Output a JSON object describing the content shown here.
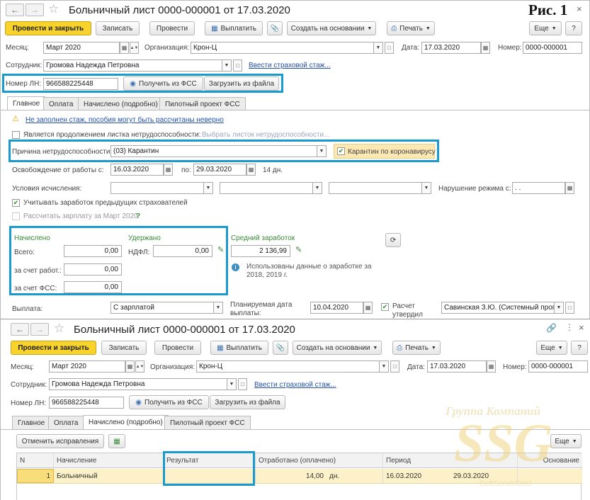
{
  "fig_label": "Рис. 1",
  "w1": {
    "title": "Больничный лист 0000-000001 от 17.03.2020",
    "toolbar": {
      "post_close": "Провести и закрыть",
      "save": "Записать",
      "post": "Провести",
      "pay": "Выплатить",
      "create_based": "Создать на основании",
      "print": "Печать",
      "more": "Еще",
      "help": "?"
    },
    "row1": {
      "month_label": "Месяц:",
      "month": "Март 2020",
      "org_label": "Организация:",
      "org": "Крон-Ц",
      "date_label": "Дата:",
      "date": "17.03.2020",
      "num_label": "Номер:",
      "num": "0000-000001"
    },
    "row2": {
      "emp_label": "Сотрудник:",
      "emp": "Громова Надежда Петровна",
      "link": "Ввести страховой стаж..."
    },
    "row3": {
      "ln_label": "Номер ЛН:",
      "ln": "966588225448",
      "get_fss": "Получить из ФСС",
      "load_file": "Загрузить из файла"
    },
    "tabs": [
      "Главное",
      "Оплата",
      "Начислено (подробно)",
      "Пилотный проект ФСС"
    ],
    "warn": "Не заполнен стаж, пособия могут быть рассчитаны неверно",
    "continuation": "Является продолжением листка нетрудоспособности:",
    "choose_sheet": "Выбрать листок нетрудоспособности...",
    "reason_label": "Причина нетрудоспособности:",
    "reason": "(03) Карантин",
    "covid": "Карантин по коронавирусу",
    "release_label": "Освобождение от работы с:",
    "release_from": "16.03.2020",
    "to_label": "по:",
    "release_to": "29.03.2020",
    "days": "14 дн.",
    "calc_cond_label": "Условия исчисления:",
    "regime_label": "Нарушение режима с:",
    "regime_value": ". .",
    "prev_employers": "Учитывать заработок предыдущих страхователей",
    "calc_salary": "Рассчитать зарплату за Март 2020",
    "calc_help": "?",
    "accrued_title": "Начислено",
    "total_label": "Всего:",
    "total": "0,00",
    "employer_label": "за счет работ.:",
    "employer": "0,00",
    "fss_label": "за счет ФСС:",
    "fss": "0,00",
    "withheld_title": "Удержано",
    "ndfl_label": "НДФЛ:",
    "ndfl": "0,00",
    "avg_title": "Средний заработок",
    "avg": "2 136,99",
    "avg_info": "Использованы данные о заработке за 2018, 2019 г.",
    "payout_label": "Выплата:",
    "payout": "С зарплатой",
    "planned_label": "Планируемая дата выплаты:",
    "planned": "10.04.2020",
    "approved_label": "Расчет утвердил",
    "approver": "Савинская З.Ю. (Системный прог"
  },
  "w2": {
    "title": "Больничный лист 0000-000001 от 17.03.2020",
    "tabs": [
      "Главное",
      "Оплата",
      "Начислено (подробно)",
      "Пилотный проект ФСС"
    ],
    "cancel_corrections": "Отменить исправления",
    "more": "Еще",
    "columns": [
      "N",
      "Начисление",
      "Результат",
      "Отработано (оплачено)",
      "Период",
      "Основание"
    ],
    "rows": [
      {
        "n": "1",
        "accrual": "Больничный",
        "result": "",
        "worked": "14,00",
        "unit": "дн.",
        "from": "16.03.2020",
        "to": "29.03.2020",
        "basis": ""
      }
    ],
    "watermark1": "Группа Компаний",
    "watermark2": "SSG",
    "watermark3": "SoftServisGold"
  }
}
